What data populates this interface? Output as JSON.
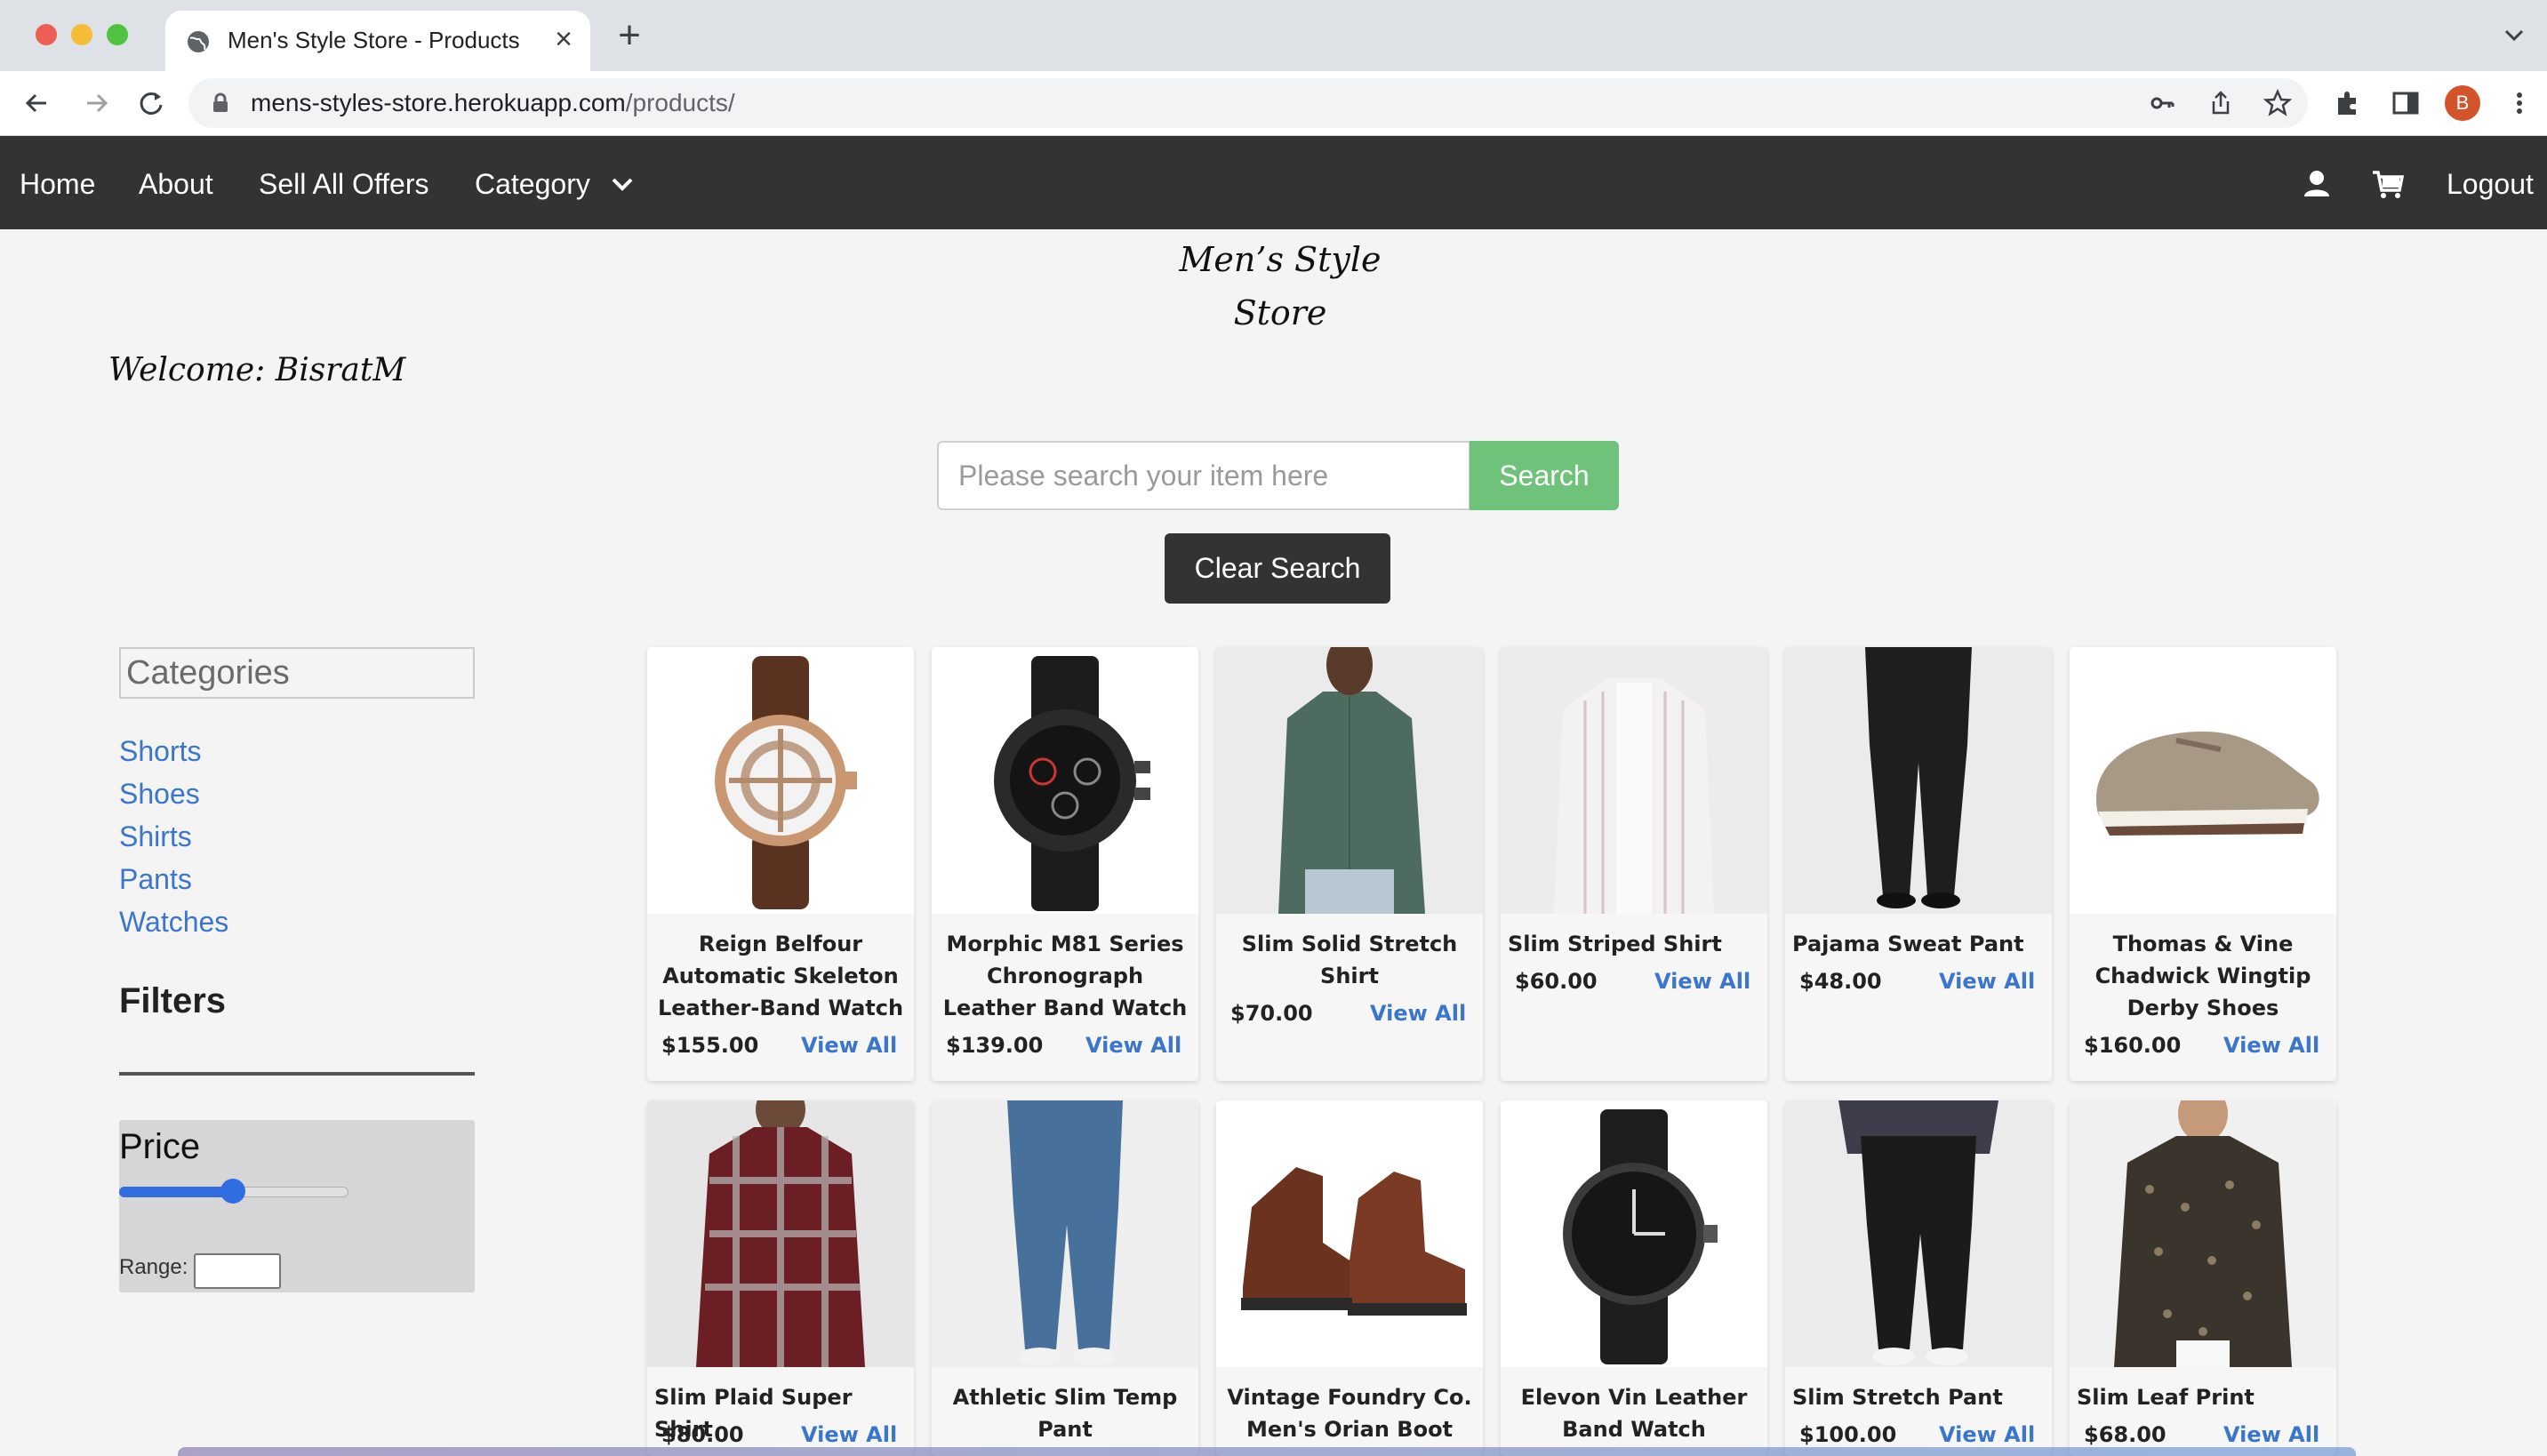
{
  "browser": {
    "tab_title": "Men's Style Store - Products",
    "url_host": "mens-styles-store.herokuapp.com",
    "url_path": "/products/",
    "profile_initial": "B"
  },
  "navbar": {
    "home": "Home",
    "about": "About",
    "sell_all_offers": "Sell All Offers",
    "category": "Category",
    "logout": "Logout"
  },
  "header": {
    "brand_line1": "Men’s Style",
    "brand_line2": "Store",
    "welcome": "Welcome: BisratM"
  },
  "search": {
    "placeholder": "Please search your item here",
    "value": "",
    "button": "Search",
    "clear_button": "Clear Search"
  },
  "sidebar": {
    "categories_title": "Categories",
    "categories": [
      "Shorts",
      "Shoes",
      "Shirts",
      "Pants",
      "Watches"
    ],
    "filters_title": "Filters",
    "price_label": "Price",
    "price_slider_fraction": 0.5,
    "range_label": "Range:",
    "range_value": ""
  },
  "colors": {
    "navbar": "#333333",
    "search_button": "#6fc27a",
    "link": "#3b76cd",
    "slider": "#2f6de1"
  },
  "products": [
    {
      "name": "Reign Belfour Automatic Skeleton Leather-Band Watch",
      "price": "$155.00",
      "link": "View All",
      "image": "watch-rose-gold-skeleton"
    },
    {
      "name": "Morphic M81 Series Chronograph Leather Band Watch",
      "price": "$139.00",
      "link": "View All",
      "image": "watch-black-chronograph"
    },
    {
      "name": "Slim Solid Stretch Shirt",
      "price": "$70.00",
      "link": "View All",
      "image": "shirt-green"
    },
    {
      "name": "Slim Striped Shirt",
      "price": "$60.00",
      "link": "View All",
      "image": "shirt-striped"
    },
    {
      "name": "Pajama Sweat Pant",
      "price": "$48.00",
      "link": "View All",
      "image": "pant-black-sweat"
    },
    {
      "name": "Thomas & Vine Chadwick Wingtip Derby Shoes",
      "price": "$160.00",
      "link": "View All",
      "image": "shoe-wingtip"
    },
    {
      "name": "Slim Plaid Super Shirt",
      "price": "$80.00",
      "link": "View All",
      "image": "shirt-plaid"
    },
    {
      "name": "Athletic Slim Temp Pant",
      "price": "",
      "link": "",
      "image": "pant-blue"
    },
    {
      "name": "Vintage Foundry Co. Men's Orian Boot",
      "price": "",
      "link": "",
      "image": "boot-brown"
    },
    {
      "name": "Elevon Vin Leather Band Watch",
      "price": "",
      "link": "",
      "image": "watch-black"
    },
    {
      "name": "Slim Stretch Pant",
      "price": "$100.00",
      "link": "View All",
      "image": "pant-black-slim"
    },
    {
      "name": "Slim Leaf Print",
      "price": "$68.00",
      "link": "View All",
      "image": "shirt-leaf-print"
    }
  ]
}
